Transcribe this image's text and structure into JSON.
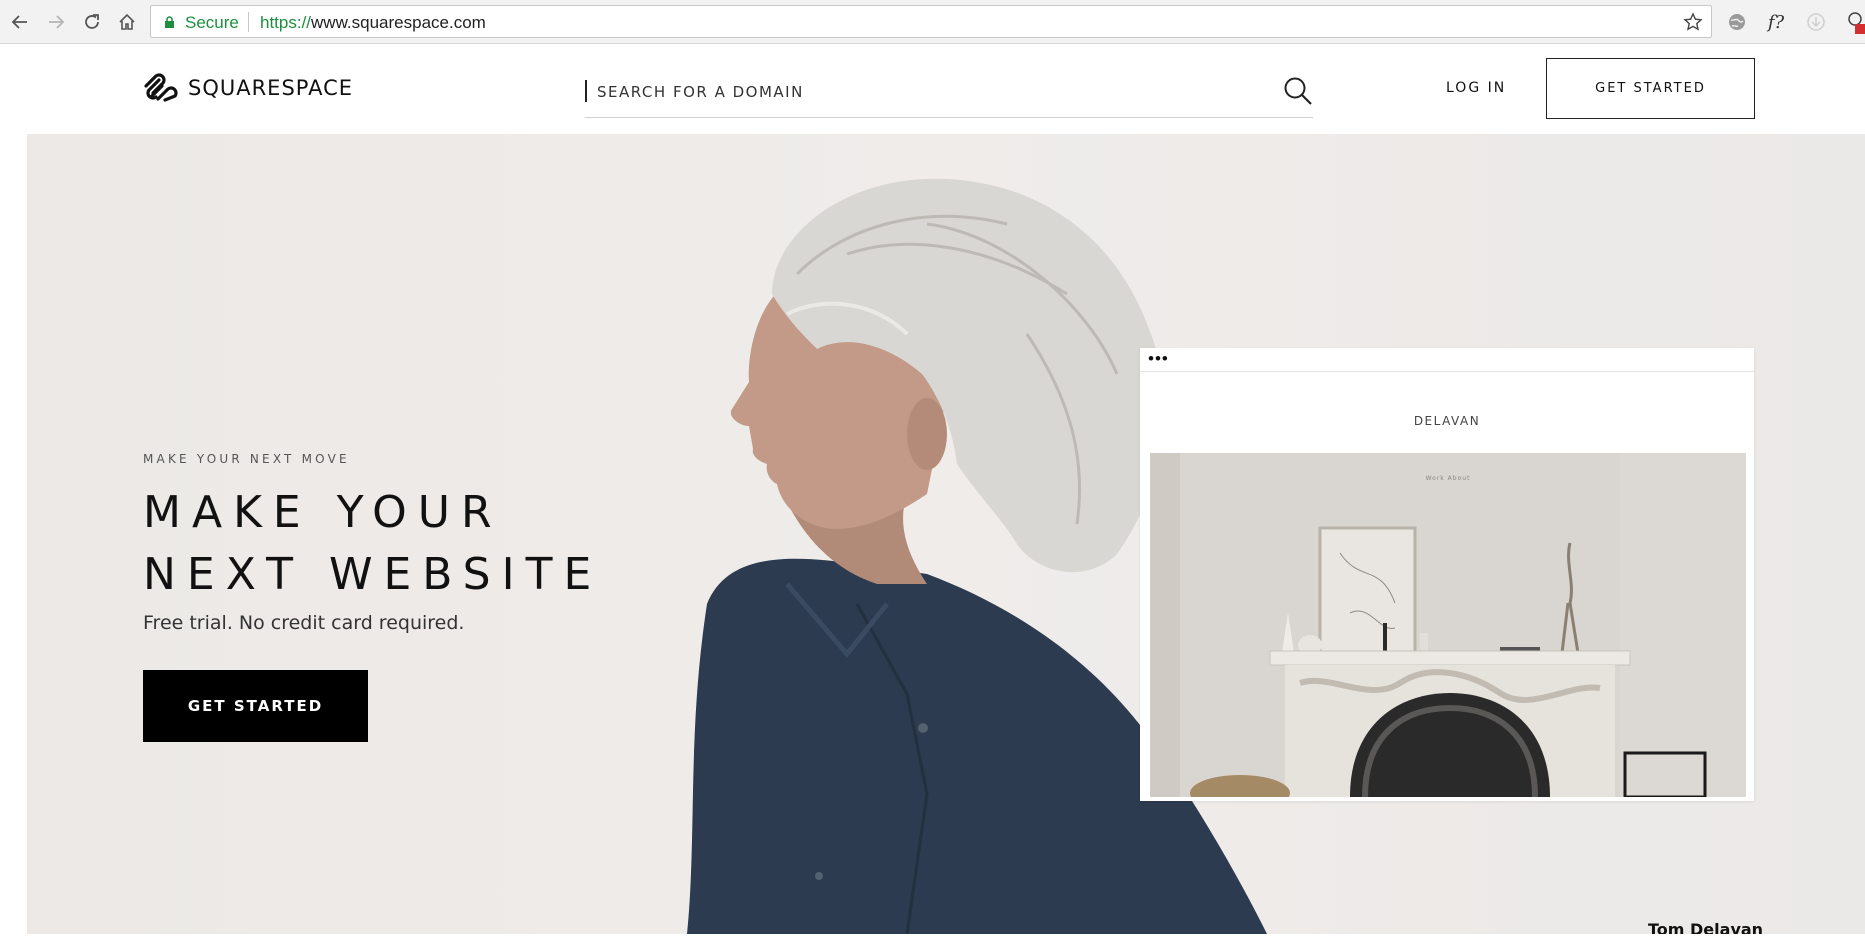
{
  "browser": {
    "secure_label": "Secure",
    "url_scheme": "https://",
    "url_rest": "www.squarespace.com",
    "extension_label": "f?"
  },
  "header": {
    "logo_text": "SQUARESPACE",
    "search_placeholder": "SEARCH FOR A DOMAIN",
    "login_label": "LOG IN",
    "get_started_label": "GET STARTED"
  },
  "hero": {
    "eyebrow": "MAKE YOUR NEXT MOVE",
    "headline_line1": "MAKE YOUR",
    "headline_line2": "NEXT WEBSITE",
    "subline": "Free trial. No credit card required.",
    "cta_label": "GET STARTED",
    "caption": "Tom Delavan"
  },
  "preview": {
    "dots": "•••",
    "site_title": "DELAVAN",
    "site_nav": "Work   About"
  },
  "colors": {
    "accent_black": "#000000",
    "secure_green": "#1e8e3e",
    "hero_bg": "#eeebe8",
    "shirt_navy": "#2b3a4d"
  }
}
